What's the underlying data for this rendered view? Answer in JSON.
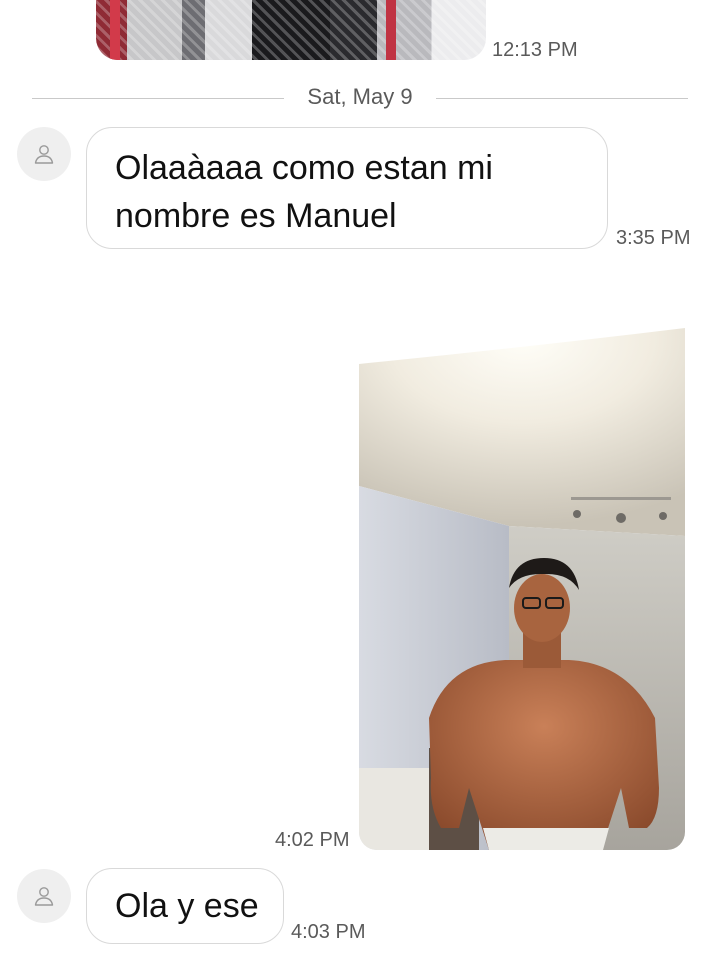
{
  "conversation": {
    "top_image_time": "12:13 PM",
    "date_divider": "Sat, May 9",
    "messages": [
      {
        "sender": "incoming",
        "text_line1": "Olaaàaaa como estan mi",
        "text_line2": "nombre es Manuel",
        "time": "3:35 PM"
      },
      {
        "sender": "outgoing",
        "type": "photo",
        "time": "4:02 PM"
      },
      {
        "sender": "incoming",
        "text": "Ola y ese",
        "time": "4:03 PM"
      }
    ]
  },
  "icons": {
    "avatar": "person-icon"
  },
  "colors": {
    "background": "#ffffff",
    "bubble_border": "#d9d9d9",
    "timestamp": "#5a5a5a",
    "avatar_bg": "#efefef"
  }
}
